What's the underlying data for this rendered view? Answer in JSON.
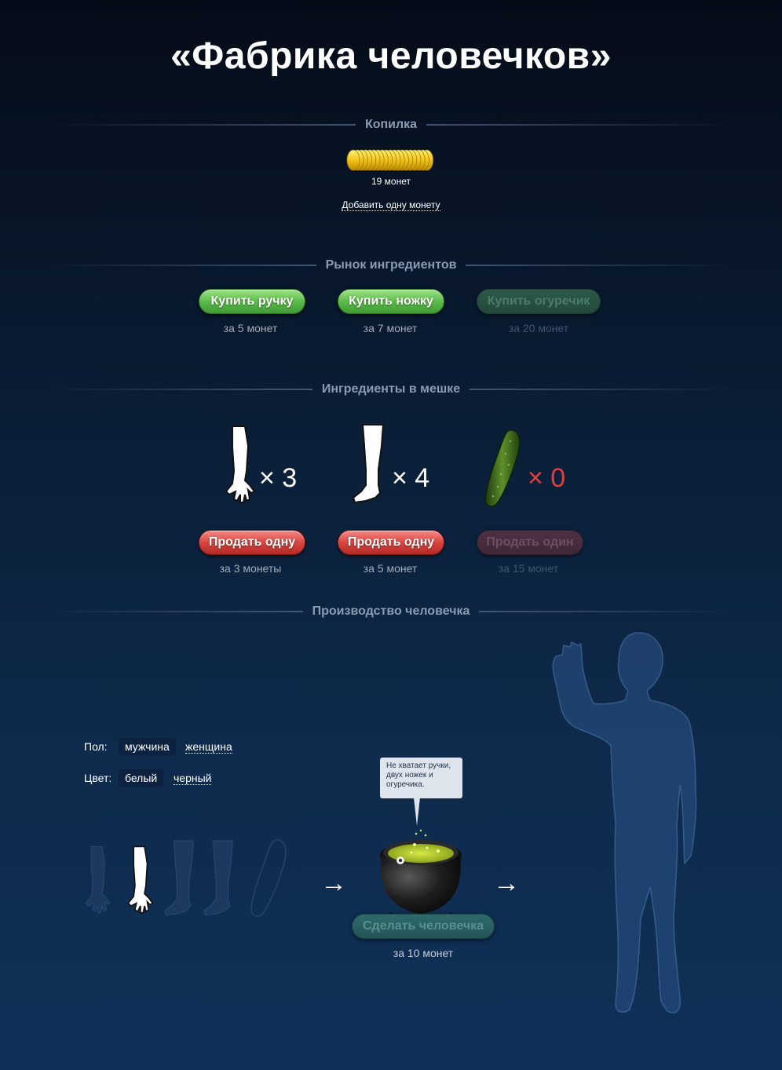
{
  "title": "«Фабрика человечков»",
  "piggy_bank": {
    "heading": "Копилка",
    "coins_text": "19 монет",
    "add_link": "Добавить одну монету"
  },
  "market": {
    "heading": "Рынок ингредиентов",
    "items": [
      {
        "label": "Купить ручку",
        "price": "за 5 монет",
        "enabled": true
      },
      {
        "label": "Купить ножку",
        "price": "за 7 монет",
        "enabled": true
      },
      {
        "label": "Купить огуречик",
        "price": "за 20 монет",
        "enabled": false
      }
    ]
  },
  "bag": {
    "heading": "Ингредиенты в мешке",
    "items": [
      {
        "icon": "arm-icon",
        "count": "× 3",
        "sell_label": "Продать одну",
        "price": "за 3 монеты",
        "enabled": true
      },
      {
        "icon": "leg-icon",
        "count": "× 4",
        "sell_label": "Продать одну",
        "price": "за 5 монет",
        "enabled": true
      },
      {
        "icon": "cucumber-icon",
        "count": "× 0",
        "sell_label": "Продать один",
        "price": "за 15 монет",
        "enabled": false
      }
    ]
  },
  "production": {
    "heading": "Производство человечка",
    "gender_label": "Пол:",
    "gender_selected": "мужчина",
    "gender_other": "женщина",
    "color_label": "Цвет:",
    "color_selected": "белый",
    "color_other": "черный",
    "arrow": "→",
    "bubble_text": "Не хватает ручки, двух ножек и огуречика.",
    "make_label": "Сделать человечка",
    "make_price": "за 10 монет",
    "make_enabled": false
  },
  "colors": {
    "accent_green": "#5cbc4b",
    "accent_red": "#d94640",
    "heading_gray": "#8b9bb2",
    "zero_red": "#e0403c"
  }
}
